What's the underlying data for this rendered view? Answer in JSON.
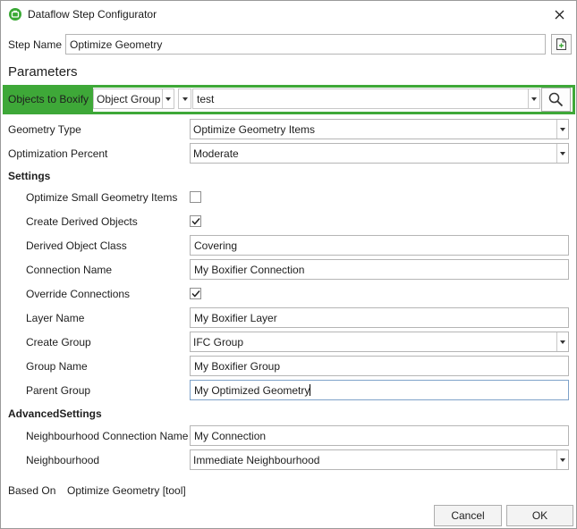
{
  "window": {
    "title": "Dataflow Step Configurator",
    "accent_color": "#3ea838"
  },
  "step": {
    "label": "Step Name",
    "value": "Optimize Geometry"
  },
  "parameters": {
    "heading": "Parameters",
    "objects_label": "Objects to Boxify",
    "object_type": "Object Group",
    "filter_value": "",
    "search_value": "test",
    "geometry_type_label": "Geometry Type",
    "geometry_type_value": "Optimize Geometry Items",
    "optimization_label": "Optimization Percent",
    "optimization_value": "Moderate"
  },
  "settings": {
    "heading": "Settings",
    "optimize_small_label": "Optimize Small Geometry Items",
    "optimize_small_checked": false,
    "create_derived_label": "Create Derived Objects",
    "create_derived_checked": true,
    "derived_class_label": "Derived Object Class",
    "derived_class_value": "Covering",
    "connection_name_label": "Connection Name",
    "connection_name_value": "My Boxifier Connection",
    "override_label": "Override Connections",
    "override_checked": true,
    "layer_name_label": "Layer Name",
    "layer_name_value": "My Boxifier Layer",
    "create_group_label": "Create Group",
    "create_group_value": "IFC Group",
    "group_name_label": "Group Name",
    "group_name_value": "My Boxifier Group",
    "parent_group_label": "Parent Group",
    "parent_group_value": "My Optimized Geometry"
  },
  "advanced": {
    "heading": "AdvancedSettings",
    "neighbourhood_conn_label": "Neighbourhood Connection Name",
    "neighbourhood_conn_value": "My Connection",
    "neighbourhood_label": "Neighbourhood",
    "neighbourhood_value": "Immediate Neighbourhood"
  },
  "footer": {
    "based_on_label": "Based On",
    "based_on_value": "Optimize Geometry [tool]",
    "cancel_label": "Cancel",
    "ok_label": "OK"
  },
  "icons": {
    "app": "dataflow-app-icon",
    "close": "close-icon",
    "new_step": "new-document-icon",
    "search": "search-icon",
    "checkmark": "checkmark-icon",
    "dropdown": "chevron-down-icon"
  }
}
